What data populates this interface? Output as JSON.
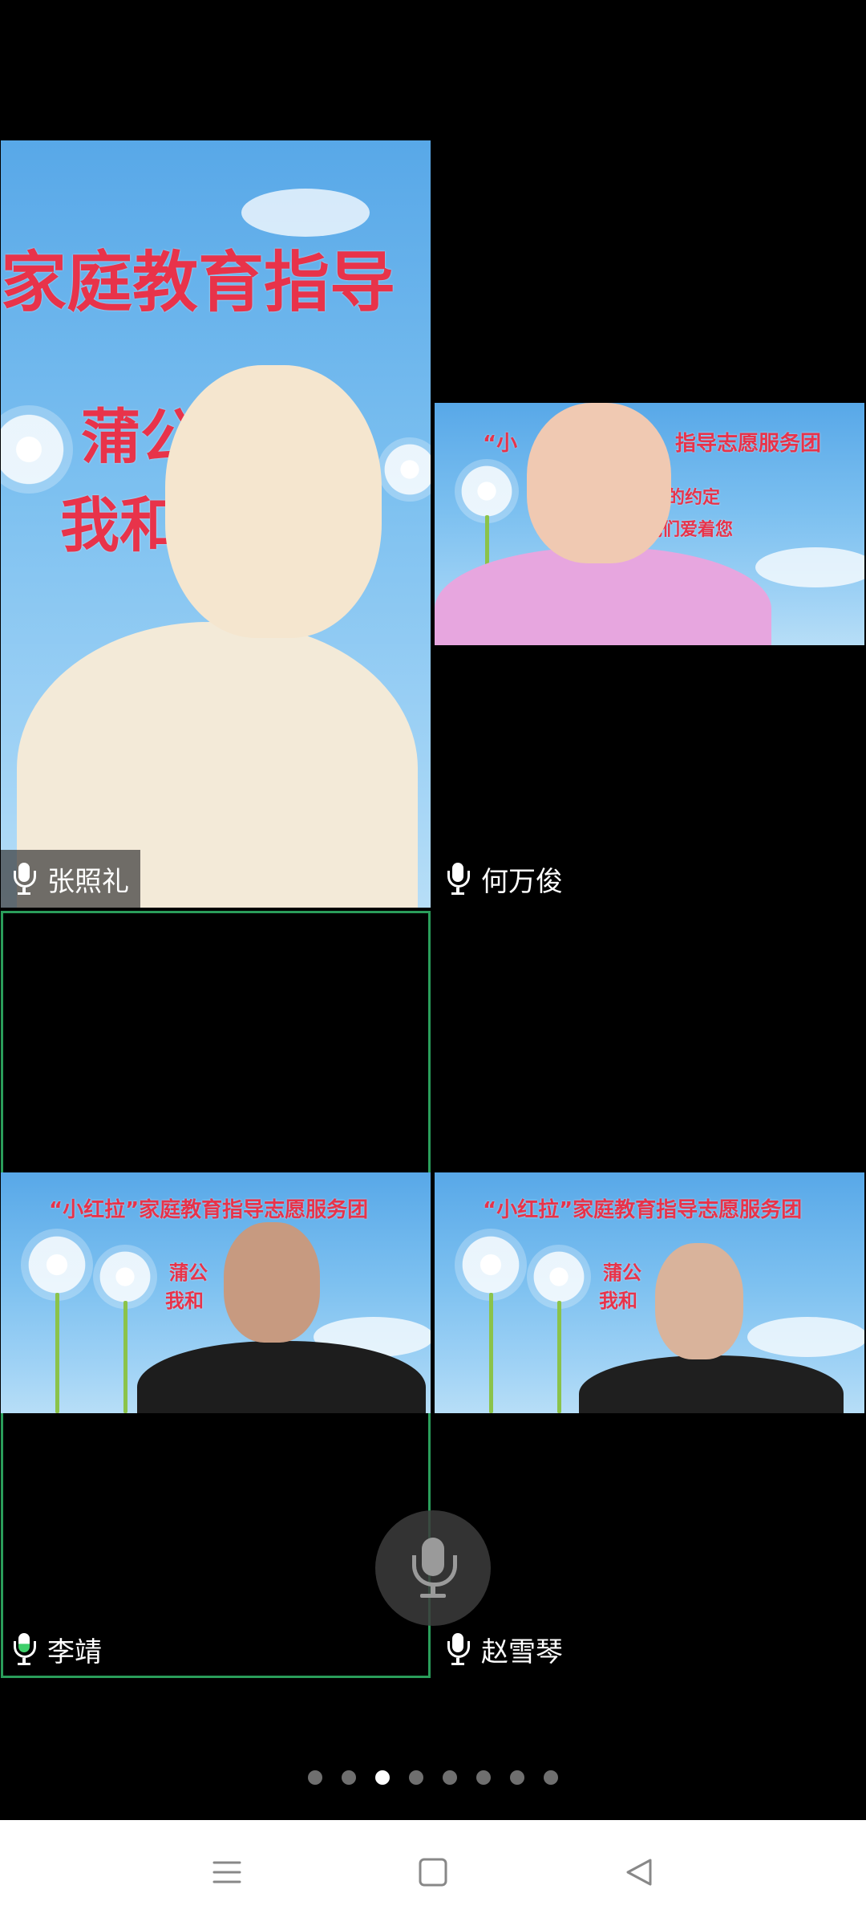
{
  "participants": [
    {
      "name": "张照礼",
      "speaking": false,
      "video_banner_line1": "家庭教育指导",
      "video_banner_line2": "蒲公",
      "video_banner_line3": "我和"
    },
    {
      "name": "何万俊",
      "speaking": false,
      "video_banner_line1": "“小",
      "video_banner_line1b": "指导志愿服务团",
      "video_banner_line2": "爱的约定",
      "video_banner_line3": "我们爱着您"
    },
    {
      "name": "李靖",
      "speaking": true,
      "video_banner_line1": "“小红拉”家庭教育指导志愿服务团",
      "video_banner_line2": "蒲公",
      "video_banner_line3": "我和"
    },
    {
      "name": "赵雪琴",
      "speaking": false,
      "video_banner_line1": "“小红拉”家庭教育指导志愿服务团",
      "video_banner_line2": "蒲公",
      "video_banner_line3": "我和"
    }
  ],
  "active_speaker_border_color": "#2a9d5a",
  "pagination": {
    "total": 8,
    "current": 3
  },
  "icons": {
    "floating": "microphone-icon",
    "nav": [
      "menu-icon",
      "home-icon",
      "back-icon"
    ]
  }
}
